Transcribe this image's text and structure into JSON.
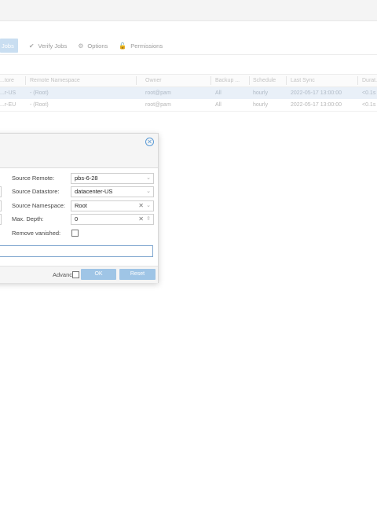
{
  "tabs": [
    {
      "label": "Jobs",
      "icon": "",
      "active": true
    },
    {
      "label": "Verify Jobs",
      "icon": "check-circle-icon",
      "active": false
    },
    {
      "label": "Options",
      "icon": "gear-icon",
      "active": false
    },
    {
      "label": "Permissions",
      "icon": "unlock-icon",
      "active": false
    }
  ],
  "table": {
    "columns": [
      "...tore",
      "Remote Namespace",
      "Owner",
      "Backup ...",
      "Schedule",
      "Last Sync",
      "Durat..."
    ],
    "rows": [
      {
        "store": "...r-US",
        "namespace": "- (Root)",
        "owner": "root@pam",
        "backup": "All",
        "schedule": "hourly",
        "last_sync": "2022-05-17 13:00:00",
        "duration": "<0.1s",
        "selected": true
      },
      {
        "store": "...r-EU",
        "namespace": "- (Root)",
        "owner": "root@pam",
        "backup": "All",
        "schedule": "hourly",
        "last_sync": "2022-05-17 13:00:00",
        "duration": "<0.1s",
        "selected": false
      }
    ]
  },
  "dialog": {
    "fields": {
      "source_remote": {
        "label": "Source Remote:",
        "value": "pbs-6-28"
      },
      "source_datastore": {
        "label": "Source Datastore:",
        "value": "datacenter-US"
      },
      "source_namespace": {
        "label": "Source Namespace:",
        "value": "Root"
      },
      "max_depth": {
        "label": "Max. Depth:",
        "value": "0"
      },
      "remove_vanished": {
        "label": "Remove vanished:",
        "checked": false
      }
    },
    "footer": {
      "advanced_label": "Advanced",
      "advanced_checked": false,
      "ok_label": "OK",
      "reset_label": "Reset"
    }
  }
}
